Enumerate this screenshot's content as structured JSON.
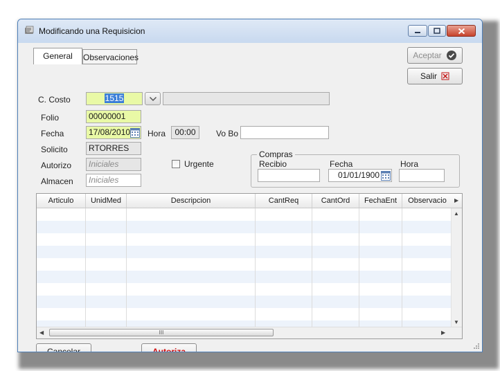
{
  "window": {
    "title": "Modificando una Requisicion"
  },
  "tabs": [
    {
      "label": "General",
      "active": true
    },
    {
      "label": "Observaciones",
      "active": false
    }
  ],
  "form": {
    "c_costo": {
      "label": "C. Costo",
      "value": "1515",
      "description": ""
    },
    "folio": {
      "label": "Folio",
      "value": "00000001"
    },
    "fecha": {
      "label": "Fecha",
      "value": "17/08/2010"
    },
    "hora": {
      "label": "Hora",
      "value": "00:00"
    },
    "vo_bo": {
      "label": "Vo Bo",
      "value": ""
    },
    "solicito": {
      "label": "Solicito",
      "value": "RTORRES"
    },
    "autorizo": {
      "label": "Autorizo",
      "placeholder": "Iniciales"
    },
    "almacen": {
      "label": "Almacen",
      "placeholder": "Iniciales"
    },
    "urgente": {
      "label": "Urgente",
      "checked": false
    }
  },
  "compras": {
    "title": "Compras",
    "recibio_label": "Recibio",
    "recibio_value": "",
    "fecha_label": "Fecha",
    "fecha_value": "01/01/1900",
    "hora_label": "Hora",
    "hora_value": ""
  },
  "buttons": {
    "aceptar": "Aceptar",
    "salir": "Salir",
    "cancelar": "Cancelar",
    "autoriza": "Autoriza"
  },
  "grid": {
    "columns": [
      "Articulo",
      "UnidMed",
      "Descripcion",
      "CantReq",
      "CantOrd",
      "FechaEnt",
      "Observacio"
    ],
    "hscroll_label": "III"
  },
  "colors": {
    "field_highlight": "#e9f9a6",
    "selection": "#3c7fd8",
    "accent_red": "#d01010",
    "row_alt": "#edf3fb"
  }
}
